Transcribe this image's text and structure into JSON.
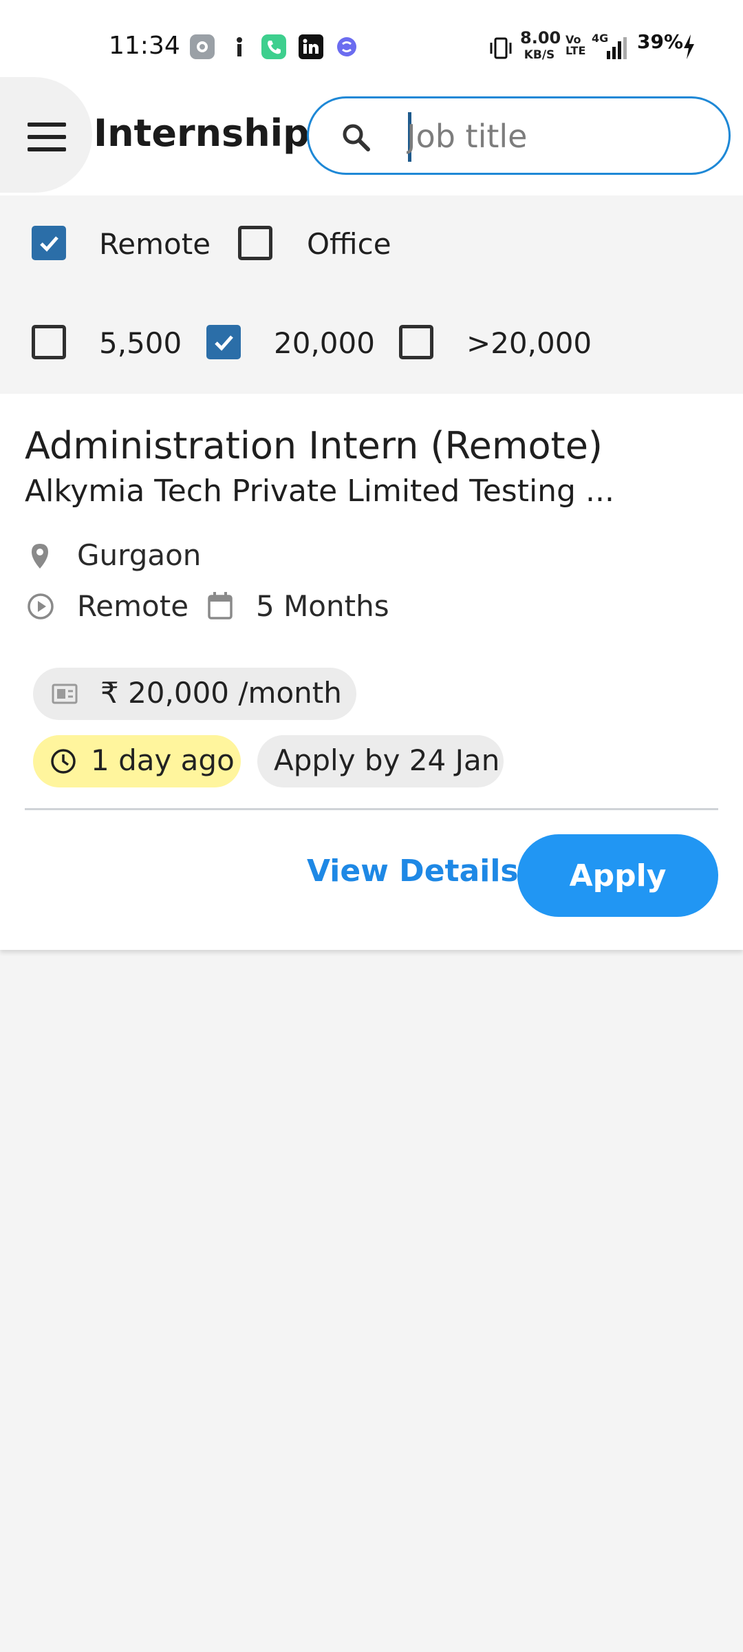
{
  "status_bar": {
    "time": "11:34",
    "network_speed": "8.00",
    "network_speed_unit": "KB/S",
    "volte": "Vo LTE",
    "signal": "4G",
    "battery": "39%"
  },
  "app_bar": {
    "title": "Internships",
    "search_placeholder": "Job title"
  },
  "filters": {
    "location": [
      {
        "label": "Remote",
        "checked": true
      },
      {
        "label": "Office",
        "checked": false
      }
    ],
    "stipend": [
      {
        "label": "5,500",
        "checked": false
      },
      {
        "label": "20,000",
        "checked": true
      },
      {
        "label": ">20,000",
        "checked": false
      }
    ]
  },
  "listing": {
    "title": "Administration Intern (Remote)",
    "company": "Alkymia Tech Private Limited Testing ...",
    "location": "Gurgaon",
    "work_type": "Remote",
    "duration": "5 Months",
    "stipend": "₹ 20,000 /month",
    "posted": "1 day ago",
    "apply_by": "Apply by 24 Jan",
    "view_details_label": "View Details",
    "apply_label": "Apply"
  },
  "colors": {
    "accent": "#2196f3",
    "checkbox_checked": "#2b6ea8",
    "posted_chip": "#fff59d",
    "search_border": "#1e88d6"
  }
}
